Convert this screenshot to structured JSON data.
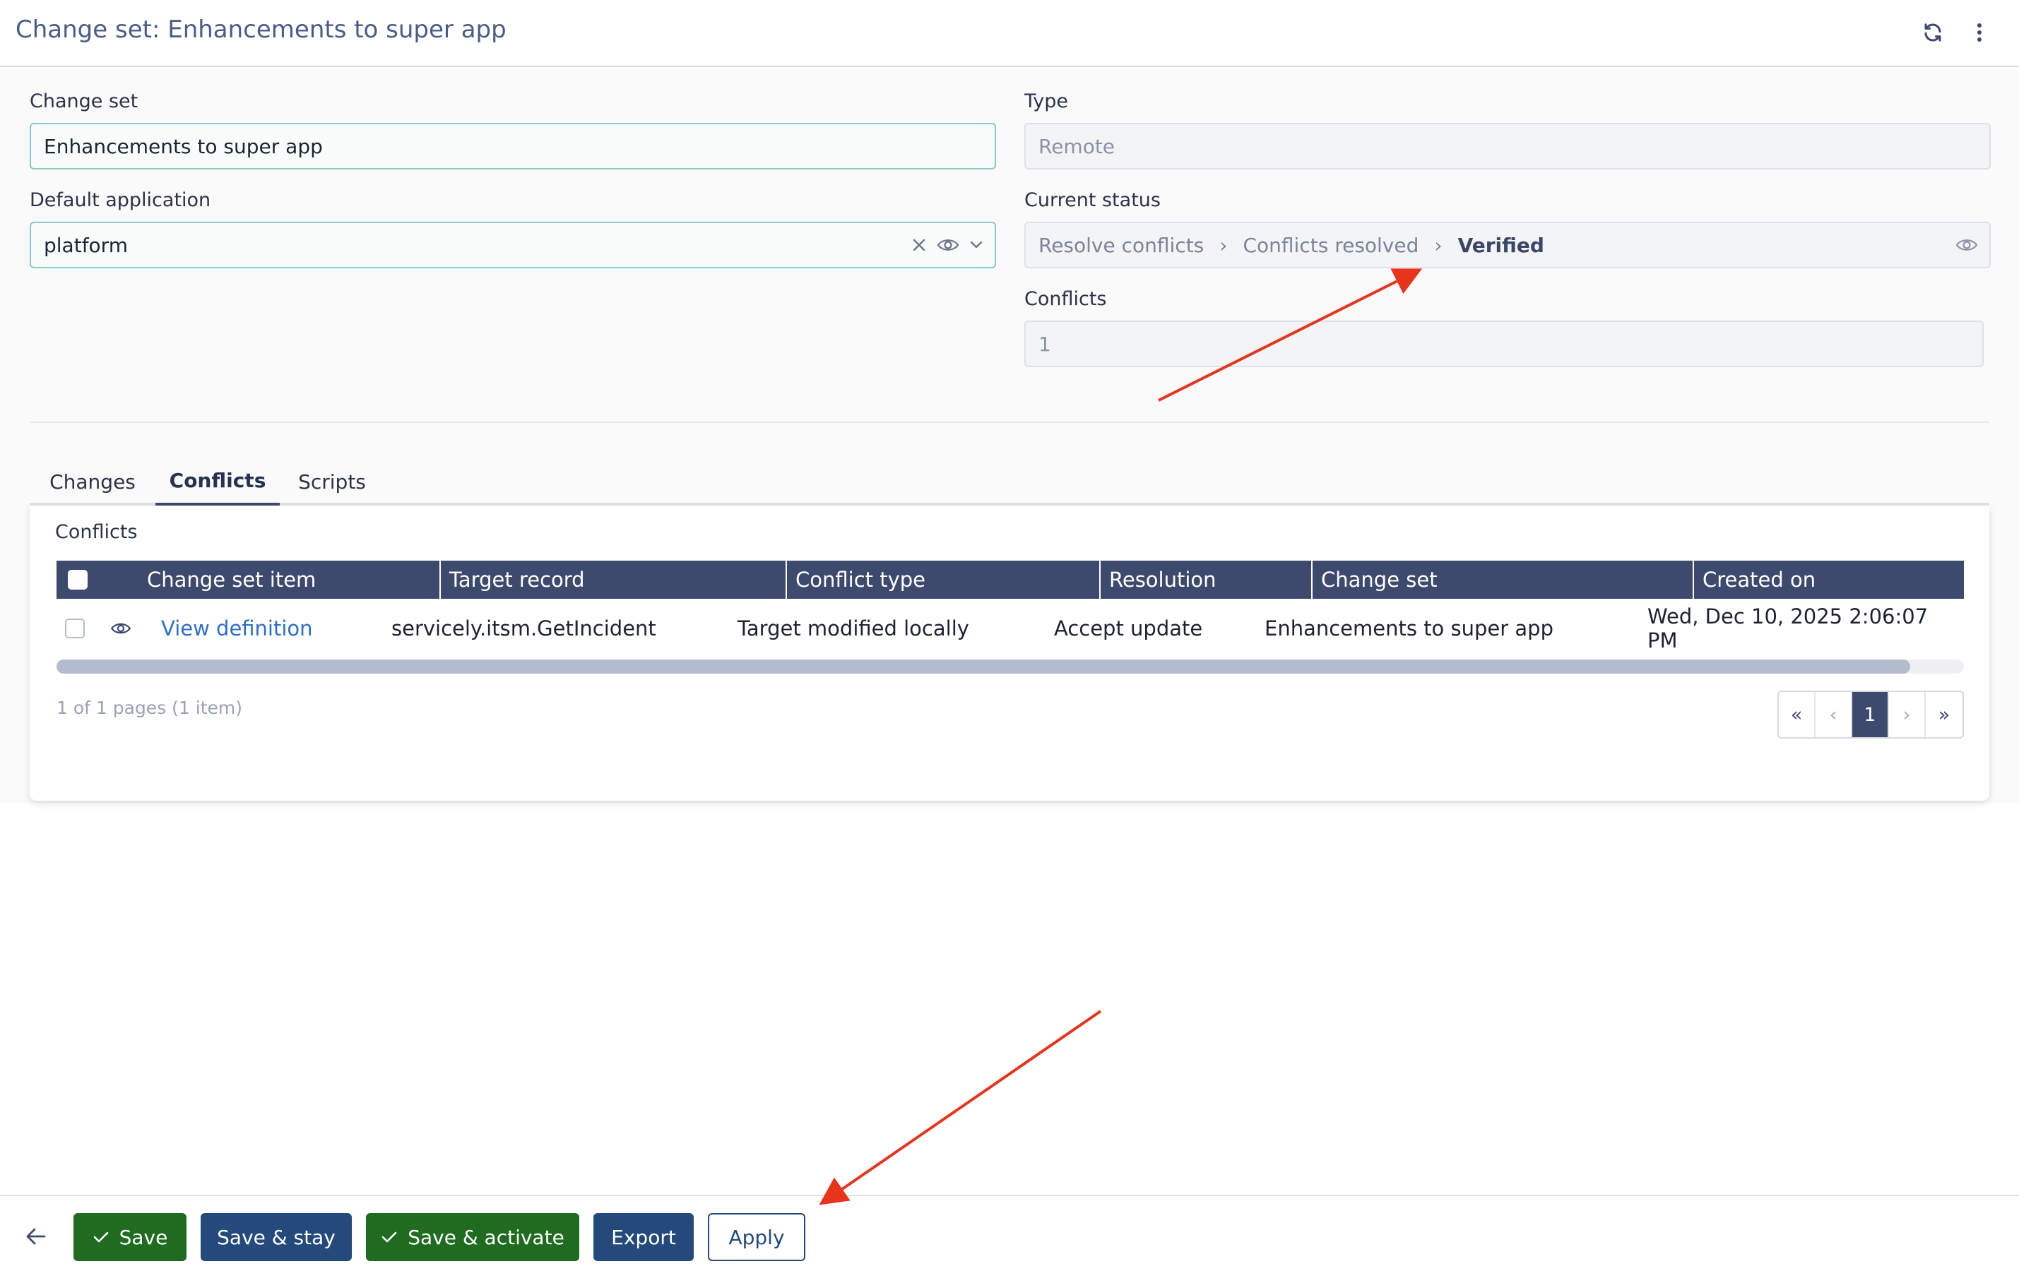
{
  "header": {
    "title": "Change set: Enhancements to super app",
    "refresh_icon": "refresh-icon",
    "more_icon": "vertical-dots-icon"
  },
  "form": {
    "change_set": {
      "label": "Change set",
      "value": "Enhancements to super app"
    },
    "default_application": {
      "label": "Default application",
      "value": "platform"
    },
    "type": {
      "label": "Type",
      "value": "Remote"
    },
    "current_status": {
      "label": "Current status",
      "steps": [
        "Resolve conflicts",
        "Conflicts resolved",
        "Verified"
      ],
      "separator": "›"
    },
    "conflicts": {
      "label": "Conflicts",
      "value": "1"
    }
  },
  "tabs": [
    {
      "label": "Changes",
      "active": false
    },
    {
      "label": "Conflicts",
      "active": true
    },
    {
      "label": "Scripts",
      "active": false
    }
  ],
  "conflicts_panel": {
    "title": "Conflicts",
    "columns": [
      "Change set item",
      "Target record",
      "Conflict type",
      "Resolution",
      "Change set",
      "Created on"
    ],
    "rows": [
      {
        "item": "View definition",
        "target_record": "servicely.itsm.GetIncident",
        "conflict_type": "Target modified locally",
        "resolution": "Accept update",
        "change_set": "Enhancements to super app",
        "created_on": "Wed, Dec 10, 2025 2:06:07 PM"
      }
    ],
    "pager_info": "1 of 1 pages (1 item)",
    "pager": {
      "first": "«",
      "prev": "‹",
      "current": "1",
      "next": "›",
      "last": "»"
    }
  },
  "footer": {
    "back_icon": "arrow-left-icon",
    "buttons": {
      "save": "Save",
      "save_stay": "Save & stay",
      "save_activate": "Save & activate",
      "export": "Export",
      "apply": "Apply"
    }
  },
  "colors": {
    "accent_navy": "#3d4a6e",
    "button_green": "#1f6b1f",
    "button_blue": "#234a7a",
    "annotation_red": "#e8341c"
  }
}
